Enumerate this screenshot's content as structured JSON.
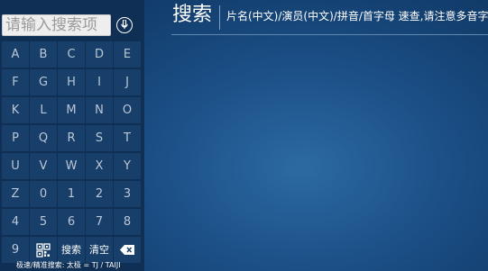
{
  "search": {
    "placeholder": "请输入搜索项",
    "voice_icon": "voice-icon"
  },
  "keyboard": {
    "rows": [
      [
        "A",
        "B",
        "C",
        "D",
        "E"
      ],
      [
        "F",
        "G",
        "H",
        "I",
        "J"
      ],
      [
        "K",
        "L",
        "M",
        "N",
        "O"
      ],
      [
        "P",
        "Q",
        "R",
        "S",
        "T"
      ],
      [
        "U",
        "V",
        "W",
        "X",
        "Y"
      ],
      [
        "Z",
        "0",
        "1",
        "2",
        "3"
      ],
      [
        "4",
        "5",
        "6",
        "7",
        "8"
      ]
    ],
    "last_row": {
      "digit": "9",
      "qr_icon": "qr-code-icon",
      "search_label": "搜索",
      "clear_label": "清空",
      "backspace_icon": "backspace-icon"
    }
  },
  "hint": "极速/精准搜索: 太极 = TJ / TAIJI",
  "header": {
    "title": "搜索",
    "subtitle": "片名(中文)/演员(中文)/拼音/首字母 速查,请注意多音字"
  },
  "colors": {
    "background": "#1b4f86",
    "left_panel": "#0f2f55",
    "key_background": "#183f6a",
    "key_text": "#b9c7d6",
    "text": "#ffffff"
  }
}
